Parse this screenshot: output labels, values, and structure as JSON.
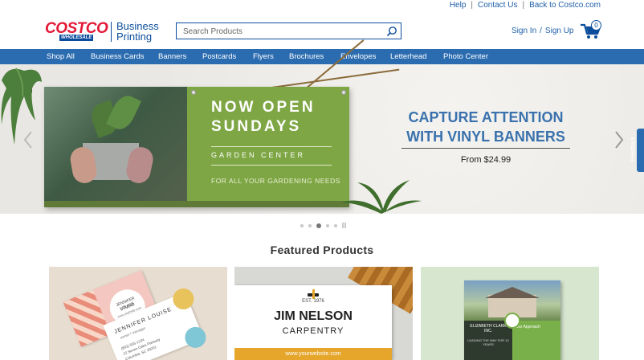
{
  "utility": {
    "help": "Help",
    "contact": "Contact Us",
    "back": "Back to Costco.com",
    "separator": "|"
  },
  "header": {
    "logo_main": "COSTCO",
    "logo_sub": "WHOLESALE",
    "brand_line1": "Business",
    "brand_line2": "Printing",
    "search_placeholder": "Search Products",
    "sign_in": "Sign In",
    "slash": "/",
    "sign_up": "Sign Up",
    "cart_count": "0",
    "accent": "#0b4d9c",
    "logo_red": "#e31837"
  },
  "nav": {
    "items": [
      "Shop All",
      "Business Cards",
      "Banners",
      "Postcards",
      "Flyers",
      "Brochures",
      "Envelopes",
      "Letterhead",
      "Photo Center"
    ],
    "color": "#2b6cb0"
  },
  "hero": {
    "banner_line1": "NOW OPEN",
    "banner_line2": "SUNDAYS",
    "banner_sub": "GARDEN CENTER",
    "banner_tag": "FOR ALL YOUR GARDENING NEEDS",
    "cta_line1": "CAPTURE ATTENTION",
    "cta_line2": "WITH VINYL BANNERS",
    "price": "From $24.99",
    "slide_count": 6,
    "active_slide": 3
  },
  "feedback": "Feedback",
  "featured": {
    "title": "Featured Products",
    "card1": {
      "name": "JENNIFER LOUISE",
      "role": "owner / manager",
      "phone": "(803) 555-1234",
      "addr1": "22 Seven Oaks Parkway",
      "addr2": "Columbia, SC 29201",
      "back_title": "JENNIFER LOUISE",
      "back_sub": "STUDIO",
      "back_url": "www.website.com"
    },
    "card2": {
      "est": "EST. 1976",
      "name": "JIM NELSON",
      "trade": "CARPENTRY",
      "url": "www.yourwebsite.com"
    },
    "card3": {
      "company": "ELIZABETH CLARK INC.",
      "approach": "Our Approach",
      "tag": "LEADING THE WAY FOR 10 YEARS"
    }
  }
}
